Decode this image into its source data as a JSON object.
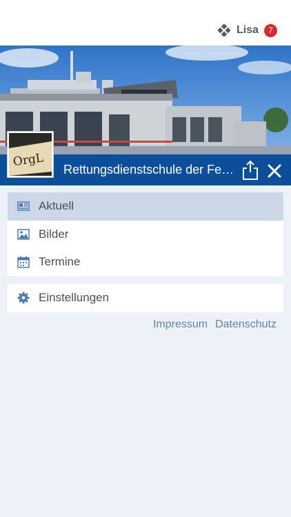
{
  "header": {
    "user_name": "Lisa",
    "notification_count": "7"
  },
  "title_bar": {
    "title": "Rettungsdienstschule der Feu..."
  },
  "avatar": {
    "logo_text": "OrgL"
  },
  "menu": {
    "items": [
      {
        "label": "Aktuell",
        "icon": "newspaper-icon",
        "active": true
      },
      {
        "label": "Bilder",
        "icon": "image-icon",
        "active": false
      },
      {
        "label": "Termine",
        "icon": "calendar-icon",
        "active": false
      }
    ],
    "settings": {
      "label": "Einstellungen",
      "icon": "gear-icon"
    }
  },
  "footer_links": {
    "impressum": "Impressum",
    "datenschutz": "Datenschutz"
  },
  "colors": {
    "accent": "#0b4f9c",
    "badge": "#d42b2b",
    "active_row": "#ccd8e8",
    "icon": "#4a7bb5",
    "link": "#5b85ad"
  }
}
